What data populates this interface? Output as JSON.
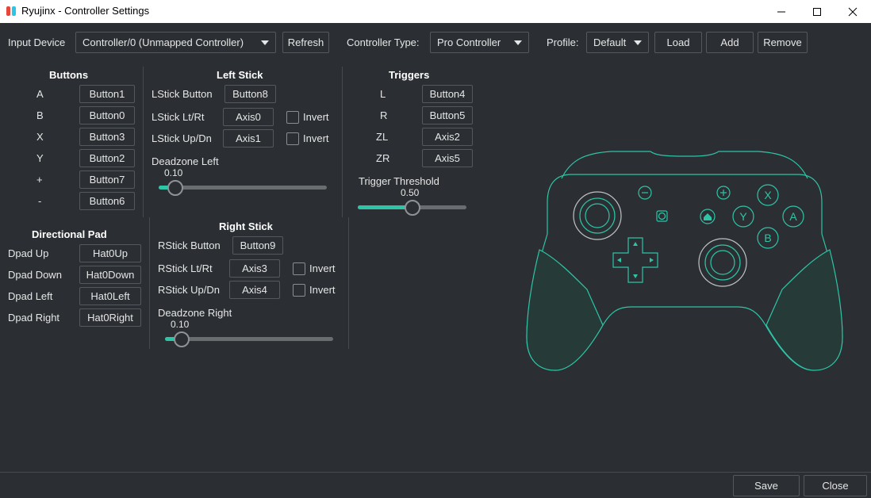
{
  "window": {
    "title": "Ryujinx - Controller Settings"
  },
  "toolbar": {
    "input_device_label": "Input Device",
    "input_device_value": "Controller/0 (Unmapped Controller)",
    "refresh_label": "Refresh",
    "controller_type_label": "Controller Type:",
    "controller_type_value": "Pro Controller",
    "profile_label": "Profile:",
    "profile_value": "Default",
    "load_label": "Load",
    "add_label": "Add",
    "remove_label": "Remove"
  },
  "buttons": {
    "title": "Buttons",
    "rows": [
      {
        "label": "A",
        "value": "Button1"
      },
      {
        "label": "B",
        "value": "Button0"
      },
      {
        "label": "X",
        "value": "Button3"
      },
      {
        "label": "Y",
        "value": "Button2"
      },
      {
        "label": "+",
        "value": "Button7"
      },
      {
        "label": "-",
        "value": "Button6"
      }
    ]
  },
  "dpad": {
    "title": "Directional Pad",
    "rows": [
      {
        "label": "Dpad Up",
        "value": "Hat0Up"
      },
      {
        "label": "Dpad Down",
        "value": "Hat0Down"
      },
      {
        "label": "Dpad Left",
        "value": "Hat0Left"
      },
      {
        "label": "Dpad Right",
        "value": "Hat0Right"
      }
    ]
  },
  "left_stick": {
    "title": "Left Stick",
    "button_label": "LStick Button",
    "button_value": "Button8",
    "lr_label": "LStick Lt/Rt",
    "lr_value": "Axis0",
    "ud_label": "LStick Up/Dn",
    "ud_value": "Axis1",
    "invert_label": "Invert",
    "deadzone_label": "Deadzone Left",
    "deadzone_value": "0.10",
    "deadzone_fraction": 0.1
  },
  "right_stick": {
    "title": "Right Stick",
    "button_label": "RStick Button",
    "button_value": "Button9",
    "lr_label": "RStick Lt/Rt",
    "lr_value": "Axis3",
    "ud_label": "RStick Up/Dn",
    "ud_value": "Axis4",
    "invert_label": "Invert",
    "deadzone_label": "Deadzone Right",
    "deadzone_value": "0.10",
    "deadzone_fraction": 0.1
  },
  "triggers": {
    "title": "Triggers",
    "rows": [
      {
        "label": "L",
        "value": "Button4"
      },
      {
        "label": "R",
        "value": "Button5"
      },
      {
        "label": "ZL",
        "value": "Axis2"
      },
      {
        "label": "ZR",
        "value": "Axis5"
      }
    ],
    "threshold_label": "Trigger Threshold",
    "threshold_value": "0.50",
    "threshold_fraction": 0.5
  },
  "controller_image": {
    "face_buttons": [
      "X",
      "Y",
      "A",
      "B"
    ],
    "accent_color": "#2ec4a6"
  },
  "footer": {
    "save_label": "Save",
    "close_label": "Close"
  }
}
